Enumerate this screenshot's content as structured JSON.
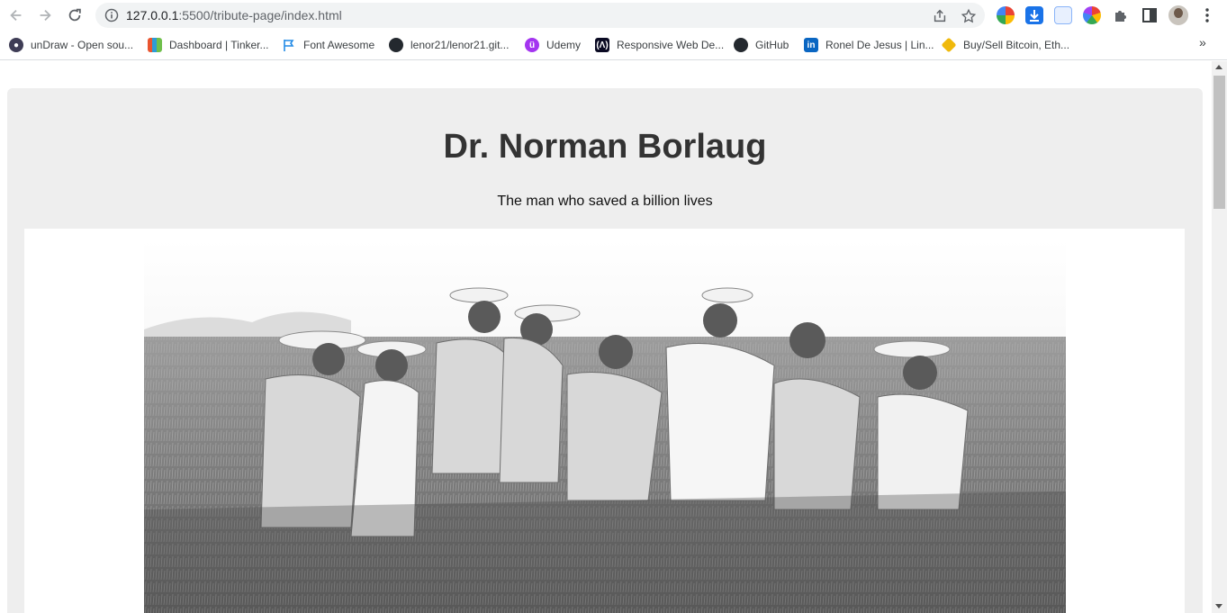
{
  "browser": {
    "url_host": "127.0.0.1",
    "url_rest": ":5500/tribute-page/index.html"
  },
  "bookmarks": [
    {
      "label": "unDraw - Open sou...",
      "icon": "undraw-icon",
      "color": "#3f3d56"
    },
    {
      "label": "Dashboard | Tinker...",
      "icon": "tinkercad-icon",
      "color": "#e9542f"
    },
    {
      "label": "Font Awesome",
      "icon": "flag-icon",
      "color": "#228ae6"
    },
    {
      "label": "lenor21/lenor21.git...",
      "icon": "github-icon",
      "color": "#24292f"
    },
    {
      "label": "Udemy",
      "icon": "udemy-icon",
      "color": "#a435f0"
    },
    {
      "label": "Responsive Web De...",
      "icon": "freecodecamp-icon",
      "color": "#0a0a23"
    },
    {
      "label": "GitHub",
      "icon": "github-icon",
      "color": "#24292f"
    },
    {
      "label": "Ronel De Jesus | Lin...",
      "icon": "linkedin-icon",
      "color": "#0a66c2"
    },
    {
      "label": "Buy/Sell Bitcoin, Eth...",
      "icon": "binance-icon",
      "color": "#f0b90b"
    }
  ],
  "page": {
    "title": "Dr. Norman Borlaug",
    "subtitle": "The man who saved a billion lives",
    "image_description": "Norman Borlaug standing with farmers in a wheat field"
  },
  "colors": {
    "main_bg": "#eeeeee",
    "title": "#333333"
  }
}
